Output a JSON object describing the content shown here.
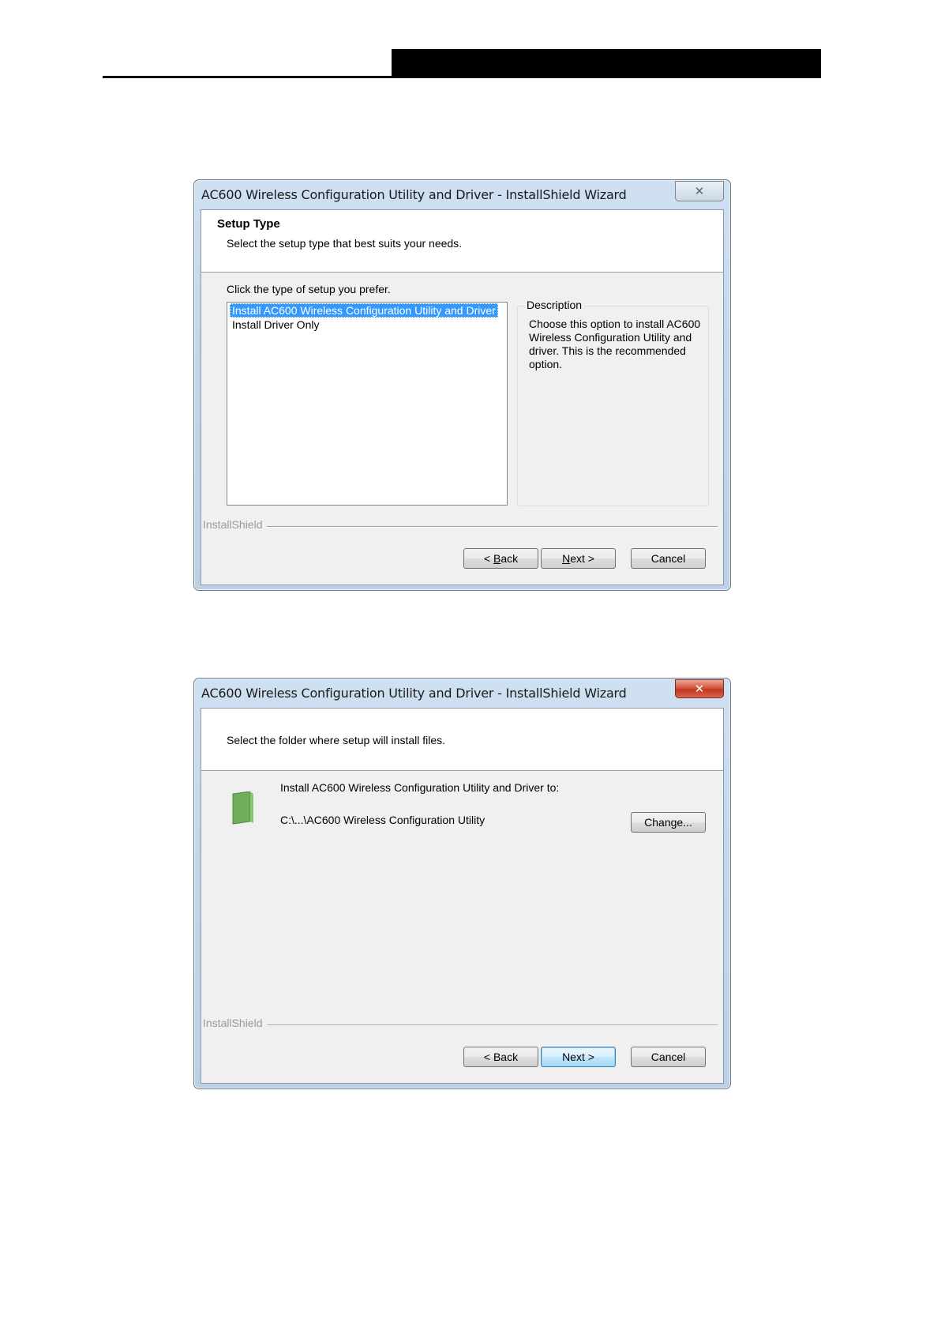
{
  "window": {
    "title": "AC600 Wireless Configuration Utility and Driver - InstallShield Wizard",
    "close_glyph": "✕"
  },
  "setup_type": {
    "heading": "Setup Type",
    "subheading": "Select the setup type that best suits your needs.",
    "prompt": "Click the type of setup you prefer.",
    "options": [
      "Install AC600 Wireless Configuration Utility and Driver",
      "Install Driver Only"
    ],
    "selected_index": 0,
    "description_label": "Description",
    "description_text": "Choose this option to install AC600 Wireless Configuration Utility and driver. This is the recommended option."
  },
  "destination": {
    "subheading": "Select the folder where setup will install files.",
    "install_to_label": "Install AC600 Wireless Configuration Utility and Driver to:",
    "path": "C:\\...\\AC600 Wireless Configuration Utility",
    "change_button": "Change...",
    "folder_icon": "folder-icon"
  },
  "footer": {
    "brand": "InstallShield",
    "back_prefix": "< ",
    "back_key": "B",
    "back_rest": "ack",
    "back_full": "< Back",
    "next_key": "N",
    "next_rest": "ext >",
    "next_full": "Next >",
    "cancel": "Cancel"
  },
  "colors": {
    "selection": "#3399ff",
    "folder": "#6fae5a"
  }
}
